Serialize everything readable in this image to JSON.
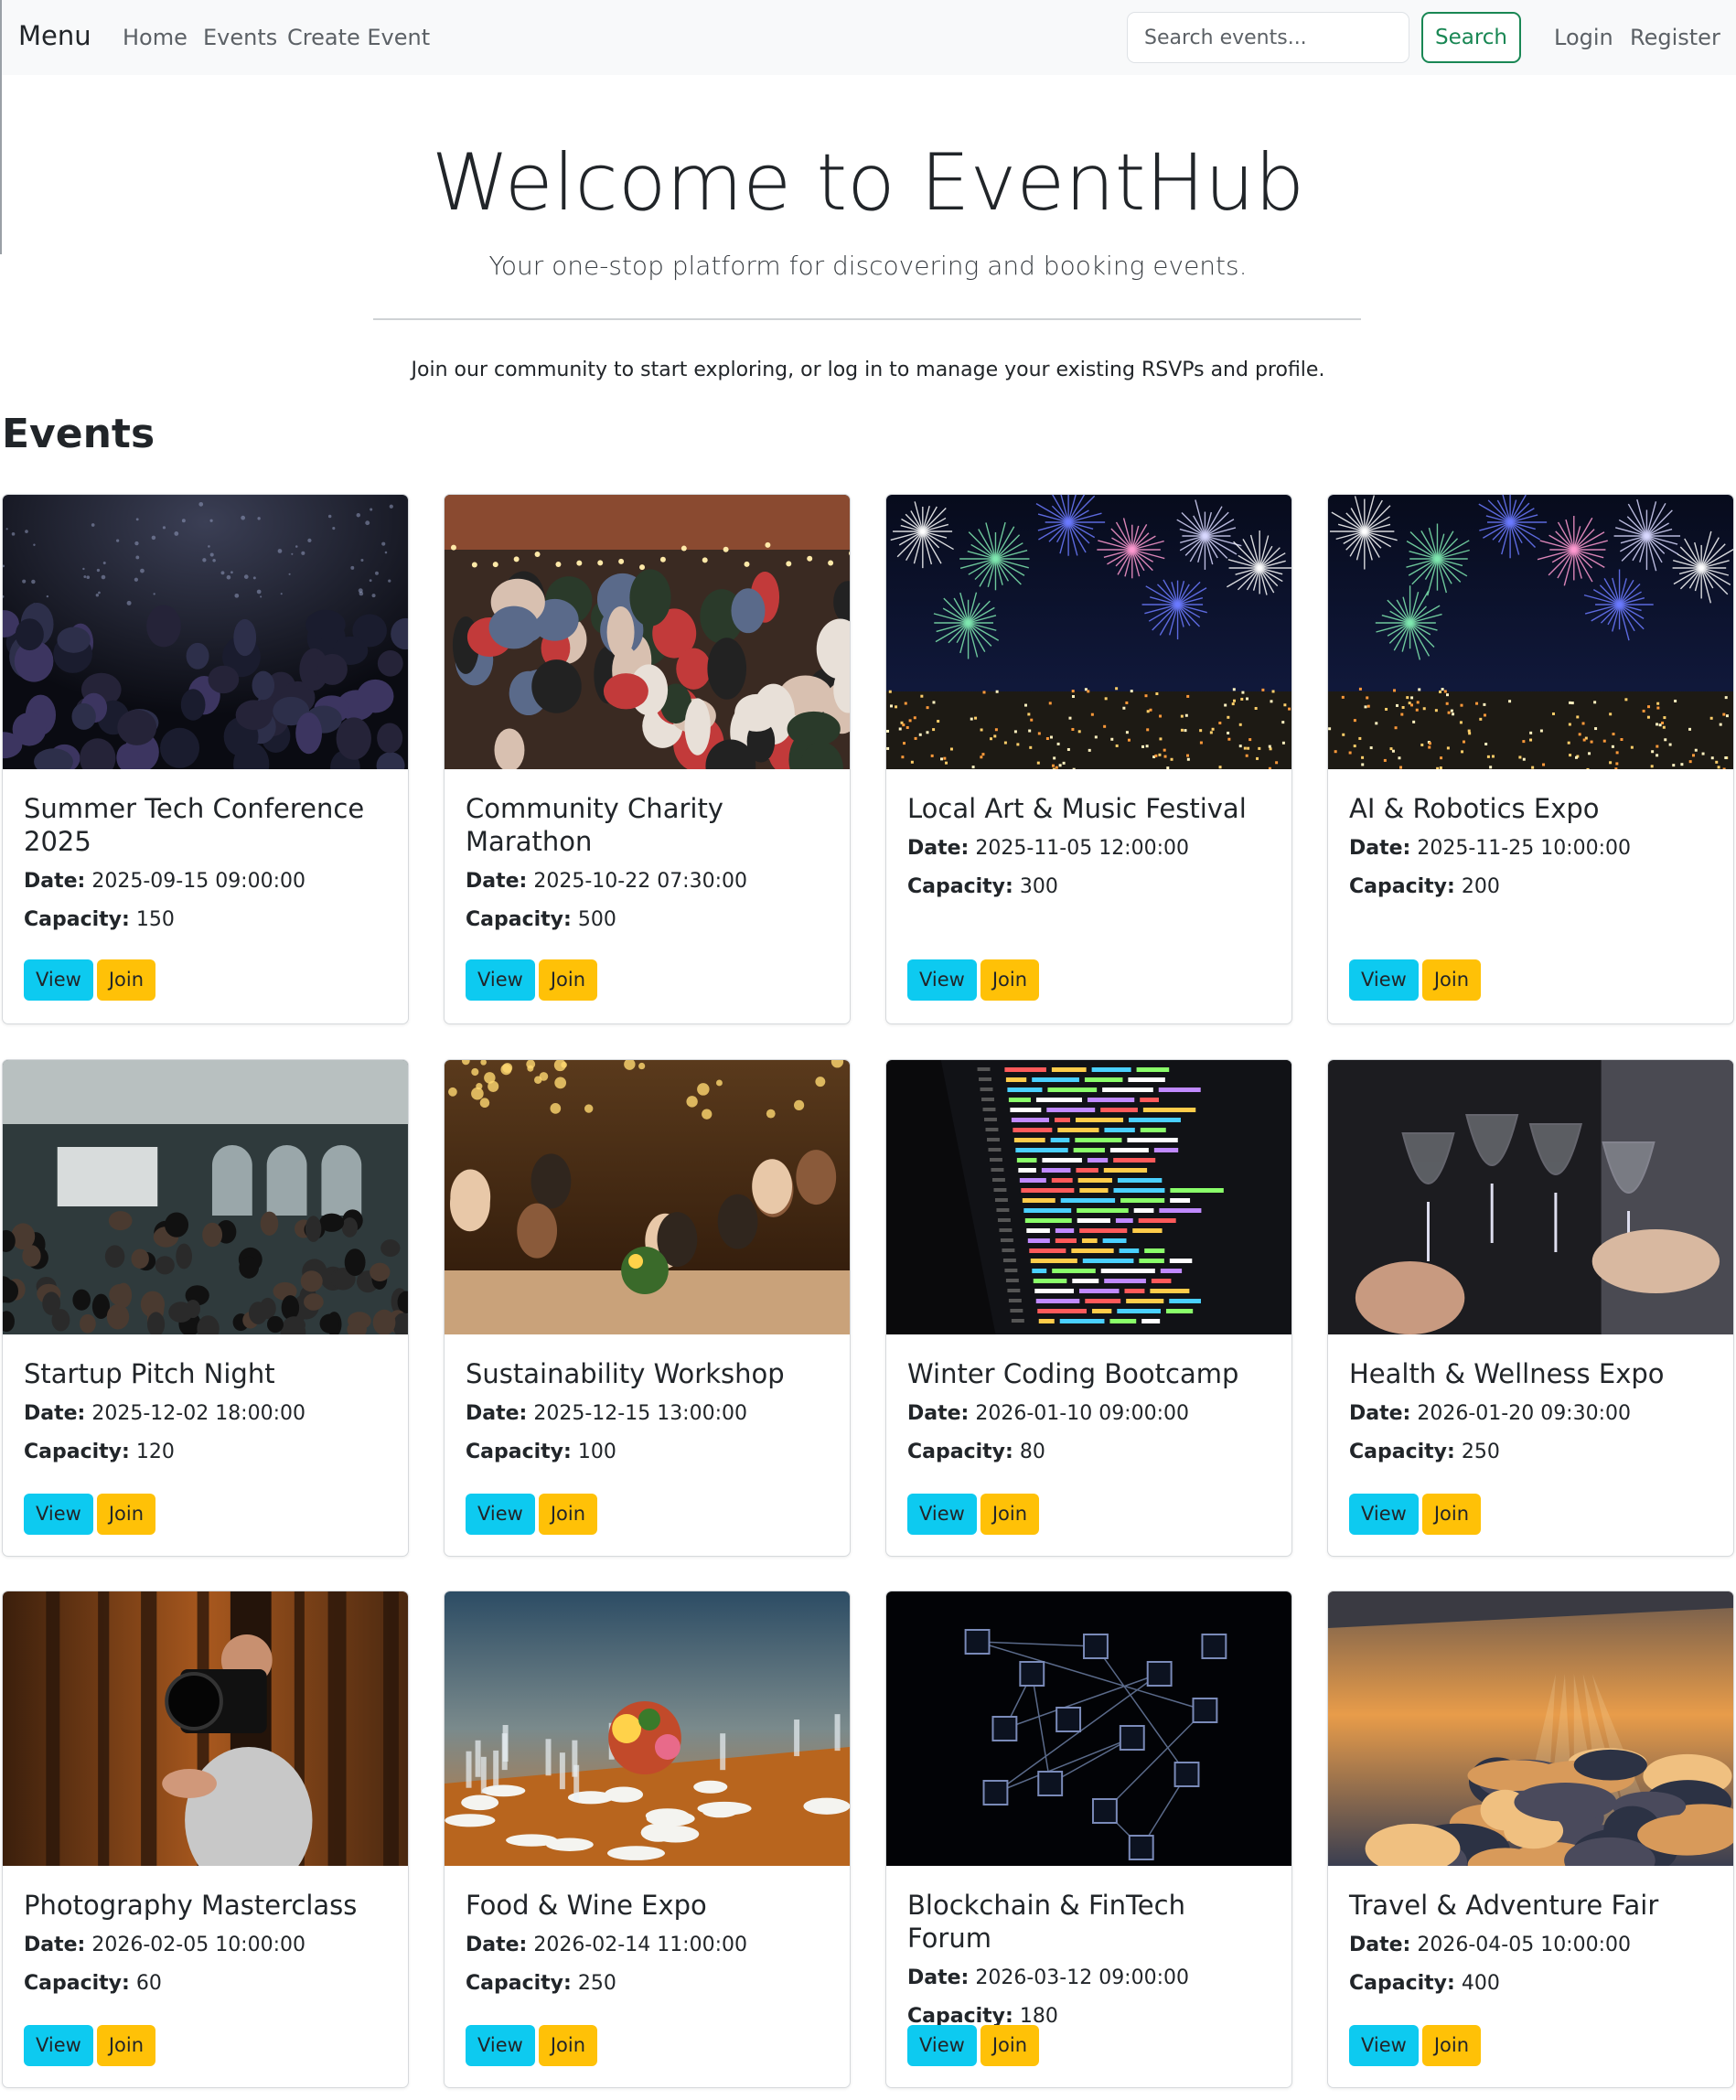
{
  "navbar": {
    "brand": "Menu",
    "links": [
      "Home",
      "Events",
      "Create Event"
    ],
    "search": {
      "placeholder": "Search events...",
      "value": "",
      "button": "Search"
    },
    "auth": [
      "Login",
      "Register"
    ]
  },
  "hero": {
    "title": "Welcome to EventHub",
    "subtitle": "Your one-stop platform for discovering and booking events.",
    "text": "Join our community to start exploring, or log in to manage your existing RSVPs and profile."
  },
  "events_heading": "Events",
  "labels": {
    "date": "Date:",
    "capacity": "Capacity:",
    "view": "View",
    "join": "Join"
  },
  "events": [
    {
      "title": "Summer Tech Conference 2025",
      "date": "2025-09-15 09:00:00",
      "capacity": "150",
      "image": "conference-audience"
    },
    {
      "title": "Community Charity Marathon",
      "date": "2025-10-22 07:30:00",
      "capacity": "500",
      "image": "crowd-party"
    },
    {
      "title": "Local Art & Music Festival",
      "date": "2025-11-05 12:00:00",
      "capacity": "300",
      "image": "fireworks-city"
    },
    {
      "title": "AI & Robotics Expo",
      "date": "2025-11-25 10:00:00",
      "capacity": "200",
      "image": "fireworks-city"
    },
    {
      "title": "Startup Pitch Night",
      "date": "2025-12-02 18:00:00",
      "capacity": "120",
      "image": "hall-audience"
    },
    {
      "title": "Sustainability Workshop",
      "date": "2025-12-15 13:00:00",
      "capacity": "100",
      "image": "dinner-toast"
    },
    {
      "title": "Winter Coding Bootcamp",
      "date": "2026-01-10 09:00:00",
      "capacity": "80",
      "image": "code-screen"
    },
    {
      "title": "Health & Wellness Expo",
      "date": "2026-01-20 09:30:00",
      "capacity": "250",
      "image": "wine-glasses"
    },
    {
      "title": "Photography Masterclass",
      "date": "2026-02-05 10:00:00",
      "capacity": "60",
      "image": "camera-forest"
    },
    {
      "title": "Food & Wine Expo",
      "date": "2026-02-14 11:00:00",
      "capacity": "250",
      "image": "banquet-table"
    },
    {
      "title": "Blockchain & FinTech Forum",
      "date": "2026-03-12 09:00:00",
      "capacity": "180",
      "image": "blockchain-cubes"
    },
    {
      "title": "Travel & Adventure Fair",
      "date": "2026-04-05 10:00:00",
      "capacity": "400",
      "image": "clouds-sunset"
    }
  ]
}
